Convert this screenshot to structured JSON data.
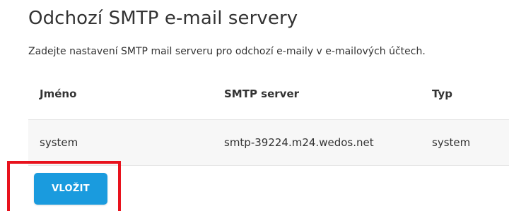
{
  "page": {
    "title": "Odchozí SMTP e-mail servery",
    "description": "Zadejte nastavení SMTP mail serveru pro odchozí e-maily v e-mailových účtech."
  },
  "table": {
    "columns": [
      "Jméno",
      "SMTP server",
      "Typ"
    ],
    "rows": [
      [
        "system",
        "smtp-39224.m24.wedos.net",
        "system"
      ]
    ]
  },
  "actions": {
    "insert_label": "VLOŽIT"
  },
  "colors": {
    "accent": "#1a9bde",
    "highlight": "#e8121d"
  }
}
